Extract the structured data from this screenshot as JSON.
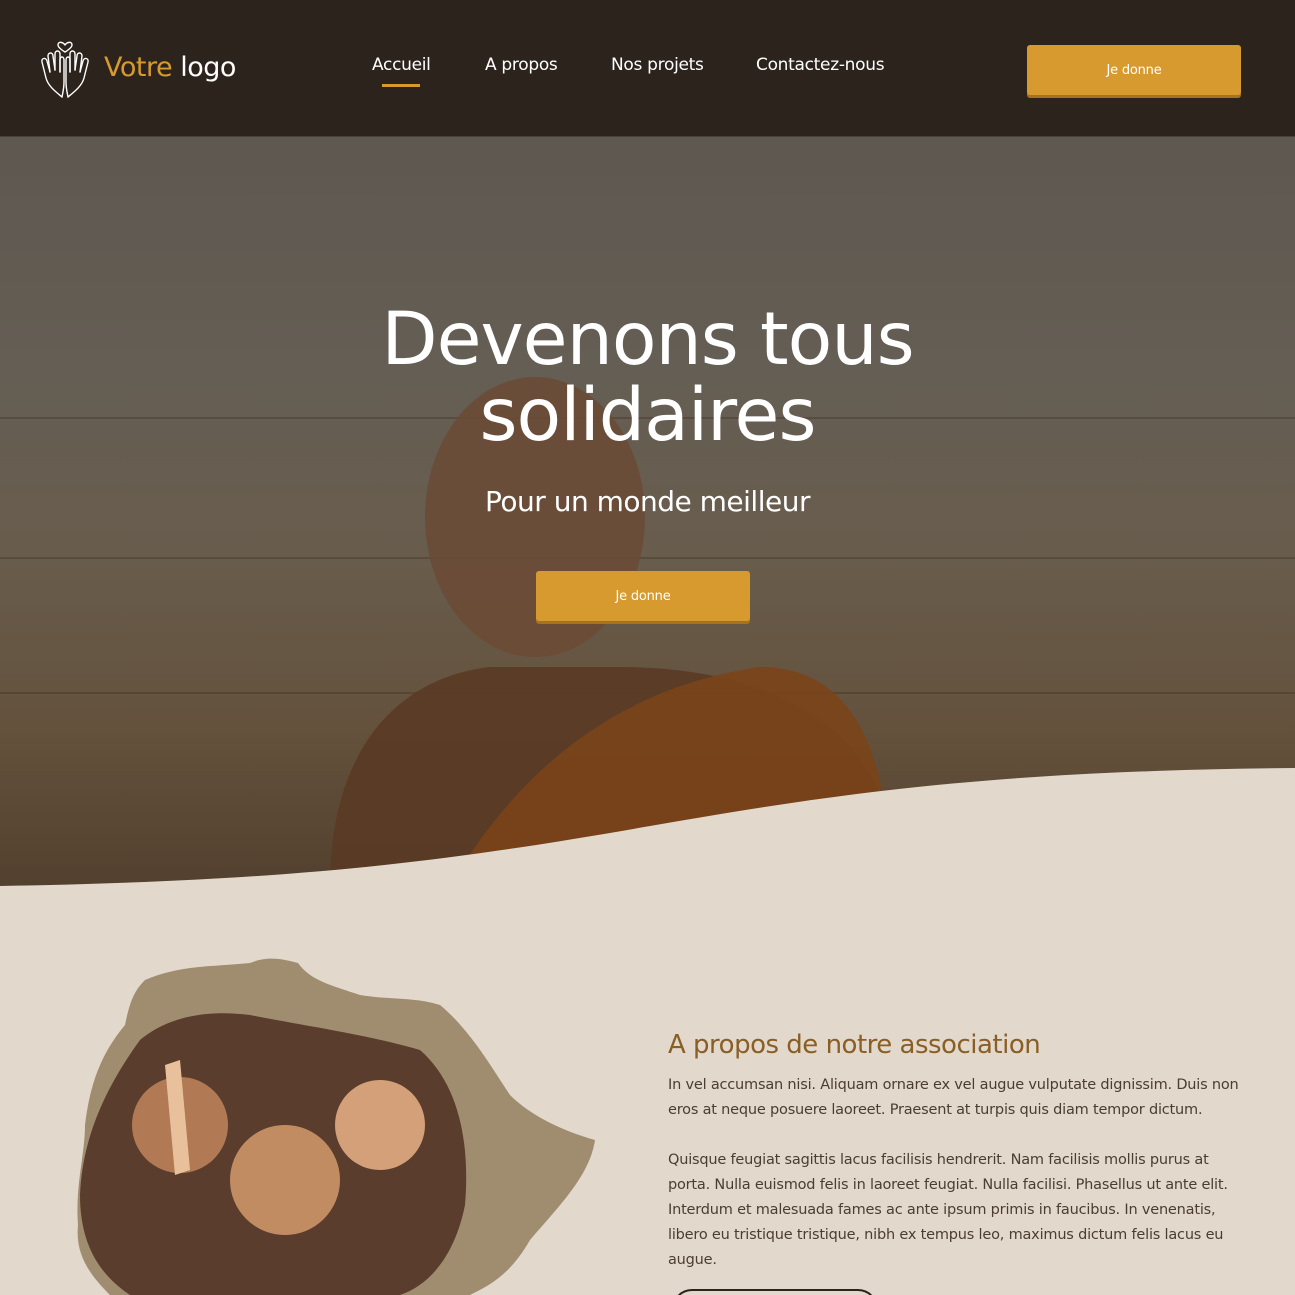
{
  "header": {
    "logo_word1": "Votre",
    "logo_word2": "logo",
    "nav": [
      "Accueil",
      "A propos",
      "Nos projets",
      "Contactez-nous"
    ],
    "active_nav": "Accueil",
    "cta_label": "Je donne"
  },
  "hero": {
    "title_line1": "Devenons tous",
    "title_line2": "solidaires",
    "subtitle": "Pour un monde meilleur",
    "cta_label": "Je donne"
  },
  "about": {
    "title": "A propos de notre association",
    "paragraph1": "In vel accumsan nisi. Aliquam ornare ex vel augue vulputate dignissim. Duis non eros at neque posuere laoreet. Praesent at turpis quis diam tempor dictum.",
    "paragraph2": "Quisque feugiat sagittis lacus facilisis hendrerit. Nam facilisis mollis purus at porta. Nulla euismod felis in laoreet feugiat. Nulla facilisi. Phasellus ut ante elit. Interdum et malesuada fames ac ante ipsum primis in faucibus. In venenatis, libero eu tristique tristique, nibh ex tempus leo, maximus dictum felis lacus eu augue."
  },
  "colors": {
    "header_bg": "#2c241c",
    "accent_gold": "#d79a2e",
    "section_bg": "#e2d8cc",
    "about_title": "#8a5f25"
  },
  "icons": {
    "logo": "praying-hands-heart-icon"
  }
}
